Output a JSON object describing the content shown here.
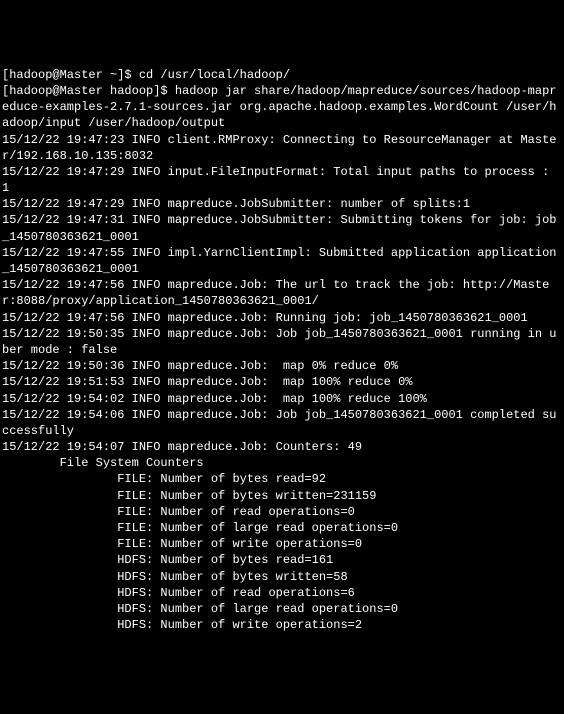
{
  "prompt1": {
    "user_host": "[hadoop@Master ~]$ ",
    "cmd": "cd /usr/local/hadoop/"
  },
  "prompt2": {
    "user_host": "[hadoop@Master hadoop]$ ",
    "cmd": "hadoop jar share/hadoop/mapreduce/sources/hadoop-mapreduce-examples-2.7.1-sources.jar org.apache.hadoop.examples.WordCount /user/hadoop/input /user/hadoop/output"
  },
  "logs": [
    "15/12/22 19:47:23 INFO client.RMProxy: Connecting to ResourceManager at Master/192.168.10.135:8032",
    "15/12/22 19:47:29 INFO input.FileInputFormat: Total input paths to process : 1",
    "15/12/22 19:47:29 INFO mapreduce.JobSubmitter: number of splits:1",
    "15/12/22 19:47:31 INFO mapreduce.JobSubmitter: Submitting tokens for job: job_1450780363621_0001",
    "15/12/22 19:47:55 INFO impl.YarnClientImpl: Submitted application application_1450780363621_0001",
    "15/12/22 19:47:56 INFO mapreduce.Job: The url to track the job: http://Master:8088/proxy/application_1450780363621_0001/",
    "15/12/22 19:47:56 INFO mapreduce.Job: Running job: job_1450780363621_0001",
    "",
    "15/12/22 19:50:35 INFO mapreduce.Job: Job job_1450780363621_0001 running in uber mode : false",
    "15/12/22 19:50:36 INFO mapreduce.Job:  map 0% reduce 0%",
    "15/12/22 19:51:53 INFO mapreduce.Job:  map 100% reduce 0%",
    "15/12/22 19:54:02 INFO mapreduce.Job:  map 100% reduce 100%",
    "15/12/22 19:54:06 INFO mapreduce.Job: Job job_1450780363621_0001 completed successfully",
    "15/12/22 19:54:07 INFO mapreduce.Job: Counters: 49",
    "        File System Counters",
    "                FILE: Number of bytes read=92",
    "                FILE: Number of bytes written=231159",
    "                FILE: Number of read operations=0",
    "                FILE: Number of large read operations=0",
    "                FILE: Number of write operations=0",
    "                HDFS: Number of bytes read=161",
    "                HDFS: Number of bytes written=58",
    "                HDFS: Number of read operations=6",
    "                HDFS: Number of large read operations=0",
    "                HDFS: Number of write operations=2"
  ]
}
